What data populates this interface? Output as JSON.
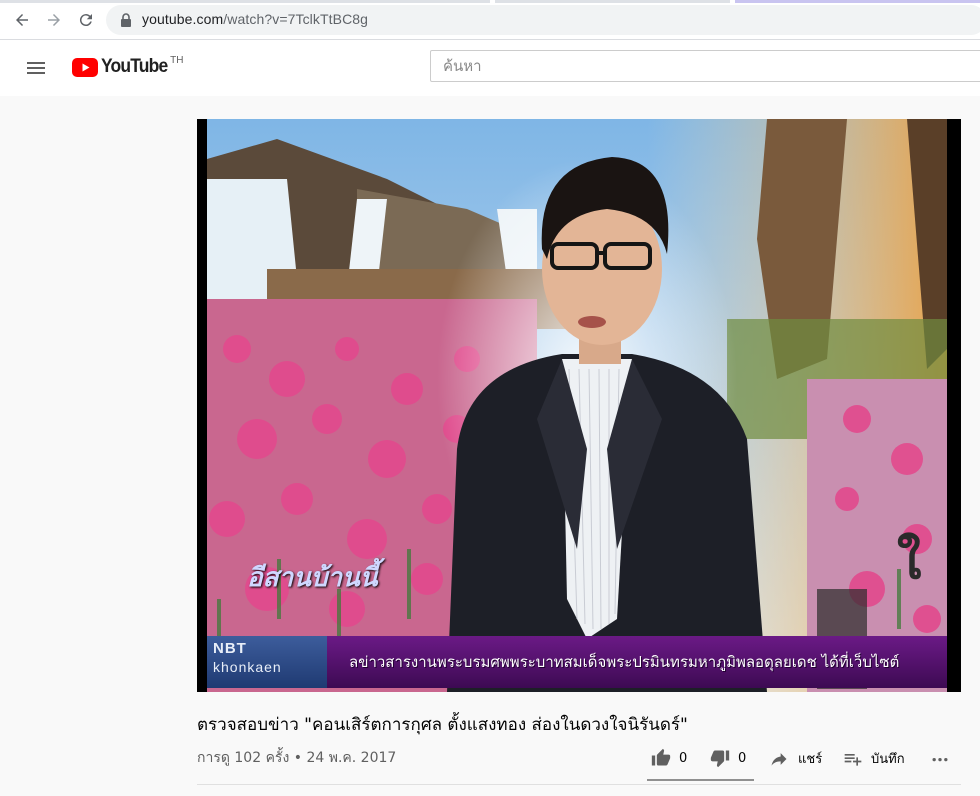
{
  "browser": {
    "url_host": "youtube.com",
    "url_path": "/watch?v=7TclkTtBC8g"
  },
  "header": {
    "logo_text": "YouTube",
    "country_code": "TH",
    "search_placeholder": "ค้นหา"
  },
  "video": {
    "station_mark": "อีสานบ้านนี้",
    "ticker_logo_line1": "NBT",
    "ticker_logo_line2": "khonkaen",
    "ticker_text": "ลข่าวสารงานพระบรมศพพระบาทสมเด็จพระปรมินทรมหาภูมิพลอดุลยเดช ได้ที่เว็บไซต์",
    "title": "ตรวจสอบข่าว \"คอนเสิร์ตการกุศล ตั้งแสงทอง ส่องในดวงใจนิรันดร์\"",
    "views_text": "การดู 102 ครั้ง",
    "separator": "•",
    "date": "24 พ.ค. 2017"
  },
  "actions": {
    "like_count": "0",
    "dislike_count": "0",
    "share_label": "แชร์",
    "save_label": "บันทึก"
  },
  "colors": {
    "accent_red": "#ff0000",
    "ticker_purple": "#5a1378",
    "text_primary": "#030303",
    "text_secondary": "#606060"
  },
  "icons": [
    "back-icon",
    "forward-icon",
    "reload-icon",
    "lock-icon",
    "menu-icon",
    "youtube-logo-icon",
    "thumb-up-icon",
    "thumb-down-icon",
    "share-icon",
    "playlist-add-icon",
    "more-icon"
  ]
}
